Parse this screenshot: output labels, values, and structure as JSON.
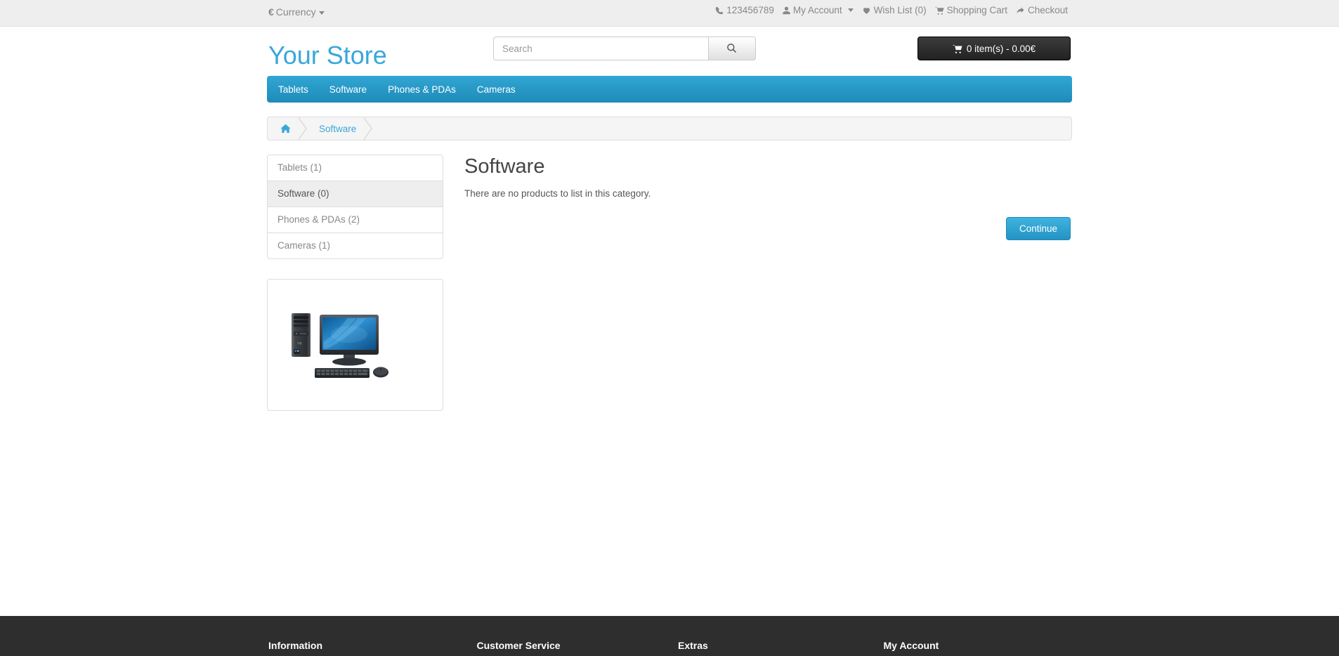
{
  "topbar": {
    "currency": {
      "symbol": "€",
      "label": "Currency"
    },
    "links": [
      {
        "icon": "phone-icon",
        "label": "123456789",
        "interactable": false
      },
      {
        "icon": "user-icon",
        "label": "My Account",
        "caret": true,
        "interactable": true
      },
      {
        "icon": "heart-icon",
        "label": "Wish List (0)",
        "interactable": true
      },
      {
        "icon": "cart-icon",
        "label": "Shopping Cart",
        "interactable": true
      },
      {
        "icon": "share-arrow-icon",
        "label": "Checkout",
        "interactable": true
      }
    ]
  },
  "header": {
    "logo": "Your Store",
    "search": {
      "value": "",
      "placeholder": "Search"
    },
    "cart_button": "0 item(s) - 0.00€"
  },
  "nav": {
    "items": [
      {
        "label": "Tablets"
      },
      {
        "label": "Software"
      },
      {
        "label": "Phones & PDAs"
      },
      {
        "label": "Cameras"
      }
    ]
  },
  "breadcrumb": {
    "items": [
      {
        "icon": "home-icon",
        "label": ""
      },
      {
        "icon": "",
        "label": "Software"
      }
    ]
  },
  "sidebar": {
    "categories": [
      {
        "label": "Tablets (1)",
        "active": false
      },
      {
        "label": "Software (0)",
        "active": true
      },
      {
        "label": "Phones & PDAs (2)",
        "active": false
      },
      {
        "label": "Cameras (1)",
        "active": false
      }
    ],
    "banner": {
      "alt": "desktop-computer-banner"
    }
  },
  "main": {
    "title": "Software",
    "empty_message": "There are no products to list in this category.",
    "continue_button": "Continue"
  },
  "footer": {
    "columns": [
      {
        "heading": "Information"
      },
      {
        "heading": "Customer Service"
      },
      {
        "heading": "Extras"
      },
      {
        "heading": "My Account"
      }
    ]
  },
  "colors": {
    "brand_blue": "#3aa7d9",
    "nav_blue_top": "#31a6d4",
    "nav_blue_bottom": "#1e8bb8",
    "topbar_bg": "#eeeeee",
    "footer_bg": "#2e2e2e",
    "muted_text": "#888888"
  }
}
